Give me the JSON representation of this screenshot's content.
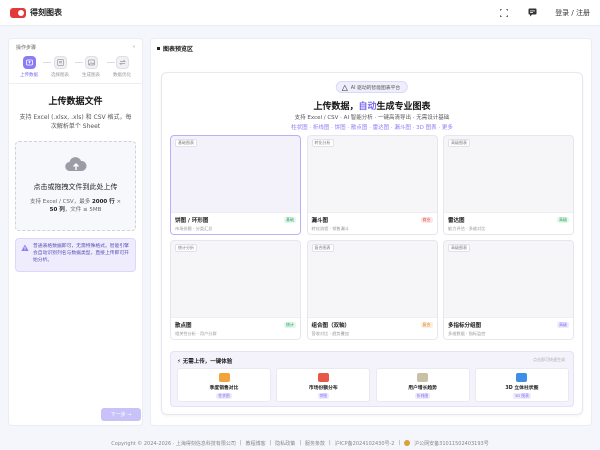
{
  "brand": {
    "name": "得刻图表"
  },
  "header": {
    "login_label": "登录 / 注册"
  },
  "steps": {
    "title": "操作步骤",
    "items": [
      {
        "label": "上传数据"
      },
      {
        "label": "选择图表"
      },
      {
        "label": "生成图表"
      },
      {
        "label": "数据优化"
      }
    ]
  },
  "upload": {
    "title": "上传数据文件",
    "desc": "支持 Excel (.xlsx, .xls) 和 CSV 格式，每次解析单个 Sheet",
    "drop_title": "点击或拖拽文件到此处上传",
    "drop_desc_prefix": "支持 Excel / CSV，最多",
    "drop_rows": "2000 行",
    "drop_mid": "×",
    "drop_cols": "50 列",
    "drop_suffix": "，文件 ≤ 5MB",
    "tip": "普通表格数据即可，无需特殊格式。智能引擎会自动识别列名与数据类型，直接上传即可开始分析。",
    "next_label": "下一步 →"
  },
  "preview": {
    "title": "图表预览区",
    "badge": "AI 驱动的智能图表平台",
    "hero_plain": "上传数据，",
    "hero_accent": "自动",
    "hero_rest": "生成专业图表",
    "hero_sub": "支持 Excel / CSV · AI 智能分析 · 一键高清导出 · 无需设计基础",
    "hero_types": "柱状图 · 折线图 · 饼图 · 散点图 · 雷达图 · 漏斗图 · 3D 图表 · 更多",
    "tiles": [
      {
        "tag": "基础图表",
        "name": "饼图 / 环形图",
        "desc": "市场份额 · 分类汇总",
        "badge": "基础",
        "badge_class": "b-green",
        "selected": true
      },
      {
        "tag": "转化分析",
        "name": "漏斗图",
        "desc": "转化流程 · 销售漏斗",
        "badge": "商业",
        "badge_class": "b-red"
      },
      {
        "tag": "高级图表",
        "name": "雷达图",
        "desc": "能力评估 · 多维对比",
        "badge": "高级",
        "badge_class": "b-green"
      },
      {
        "tag": "统计分析",
        "name": "散点图",
        "desc": "相关性分析 · 用户分群",
        "badge": "统计",
        "badge_class": "b-green"
      },
      {
        "tag": "复合图表",
        "name": "组合图（双轴）",
        "desc": "营收对比 · 趋势叠加",
        "badge": "复合",
        "badge_class": "b-orange"
      },
      {
        "tag": "高级图表",
        "name": "多指标分组图",
        "desc": "多维数据 · 指标监控",
        "badge": "高级",
        "badge_class": "b-purple"
      }
    ],
    "quick": {
      "title": "无需上传，一键体验",
      "hint": "点击即可快速生成",
      "items": [
        {
          "name": "季度销售对比",
          "tag": "柱状图",
          "color": "#f2a33a"
        },
        {
          "name": "市场份额分布",
          "tag": "饼图",
          "color": "#e8564a"
        },
        {
          "name": "用户增长趋势",
          "tag": "折线图",
          "color": "#c9c0a8"
        },
        {
          "name": "3D 立体柱状图",
          "tag": "3D 图表",
          "color": "#3f8fe6"
        }
      ]
    }
  },
  "footer": {
    "copyright": "Copyright © 2024-2026 · 上海得刻信息科技有限公司",
    "links": [
      "教程博客",
      "隐私政策",
      "服务条款"
    ],
    "icp": "沪ICP备2024102430号-2",
    "police": "沪公网安备31011502403193号"
  }
}
